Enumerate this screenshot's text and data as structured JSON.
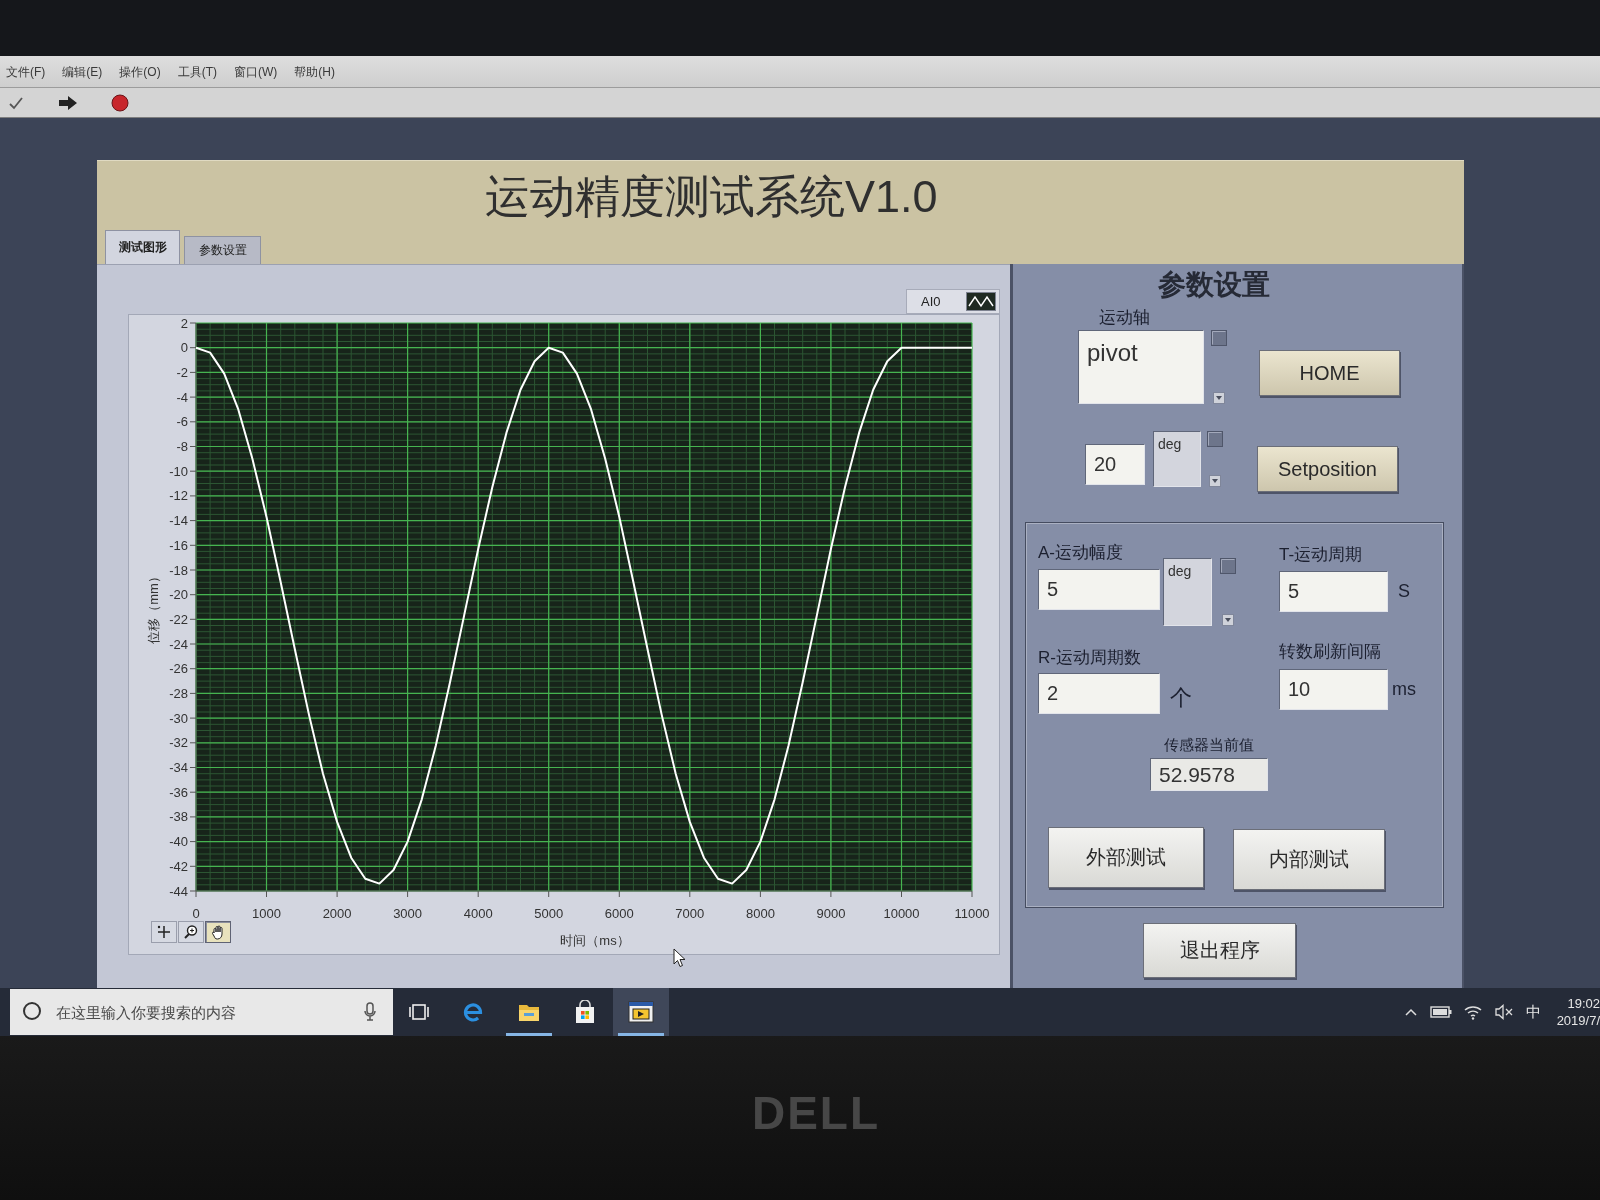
{
  "menu_bar": {
    "items": [
      "文件(F)",
      "编辑(E)",
      "操作(O)",
      "工具(T)",
      "窗口(W)",
      "帮助(H)"
    ]
  },
  "vi_panel": {
    "title": "运动精度测试系统V1.0",
    "tabs": [
      {
        "label": "测试图形",
        "selected": true
      },
      {
        "label": "参数设置",
        "selected": false
      }
    ]
  },
  "graph": {
    "chart_data": {
      "type": "line",
      "xlabel": "时间（ms）",
      "ylabel": "位移（mm）",
      "x": [
        0,
        200,
        400,
        600,
        800,
        1000,
        1200,
        1400,
        1600,
        1800,
        2000,
        2200,
        2400,
        2600,
        2800,
        3000,
        3200,
        3400,
        3600,
        3800,
        4000,
        4200,
        4400,
        4600,
        4800,
        5000,
        5200,
        5400,
        5600,
        5800,
        6000,
        6200,
        6400,
        6600,
        6800,
        7000,
        7200,
        7400,
        7600,
        7800,
        8000,
        8200,
        8400,
        8600,
        8800,
        9000,
        9200,
        9400,
        9600,
        9800,
        10000,
        10200,
        10400,
        10600,
        10800,
        11000
      ],
      "series": [
        {
          "name": "AI0",
          "color": "#ffffff",
          "values": [
            0,
            -0.4,
            -2.1,
            -5.0,
            -9.0,
            -13.7,
            -19.0,
            -24.4,
            -29.7,
            -34.5,
            -38.4,
            -41.3,
            -43.0,
            -43.4,
            -42.3,
            -40.0,
            -36.6,
            -32.2,
            -27.1,
            -21.7,
            -16.3,
            -11.3,
            -6.9,
            -3.4,
            -1.1,
            0,
            -0.4,
            -2.1,
            -5.0,
            -9.0,
            -13.7,
            -19.0,
            -24.4,
            -29.7,
            -34.5,
            -38.4,
            -41.3,
            -43.0,
            -43.4,
            -42.3,
            -40.0,
            -36.6,
            -32.2,
            -27.1,
            -21.7,
            -16.3,
            -11.3,
            -6.9,
            -3.4,
            -1.1,
            0,
            0,
            0,
            0,
            0,
            0
          ]
        }
      ],
      "xlim": [
        0,
        11000
      ],
      "ylim": [
        -44,
        2
      ],
      "xticks": [
        0,
        1000,
        2000,
        3000,
        4000,
        5000,
        6000,
        7000,
        8000,
        9000,
        10000,
        11000
      ],
      "yticks": [
        2,
        0,
        -2,
        -4,
        -6,
        -8,
        -10,
        -12,
        -14,
        -16,
        -18,
        -20,
        -22,
        -24,
        -26,
        -28,
        -30,
        -32,
        -34,
        -36,
        -38,
        -40,
        -42,
        -44
      ],
      "grid": true
    },
    "palette": [
      {
        "kind": "cursor",
        "selected": false
      },
      {
        "kind": "zoom",
        "selected": false
      },
      {
        "kind": "pan",
        "selected": true
      }
    ]
  },
  "settings": {
    "title": "参数设置",
    "axis": {
      "label": "运动轴",
      "value": "pivot"
    },
    "home_button": "HOME",
    "position": {
      "value": "20",
      "unit": "deg"
    },
    "setposition_button": "Setposition",
    "motion": {
      "amplitude": {
        "label": "A-运动幅度",
        "value": "5",
        "unit": "deg"
      },
      "period": {
        "label": "T-运动周期",
        "value": "5",
        "unit": "S"
      },
      "cycles": {
        "label": "R-运动周期数",
        "value": "2",
        "unit": "个"
      },
      "refresh_interval": {
        "label": "转数刷新间隔",
        "value": "10",
        "unit": "ms"
      },
      "sensor": {
        "label": "传感器当前值",
        "value": "52.9578"
      },
      "buttons": [
        "外部测试",
        "内部测试"
      ]
    },
    "exit_button": "退出程序"
  },
  "taskbar": {
    "search": {
      "placeholder": "在这里输入你要搜索的内容"
    },
    "apps": [
      {
        "kind": "task-view",
        "running": false,
        "active": false
      },
      {
        "kind": "browser",
        "running": false,
        "active": false
      },
      {
        "kind": "folder",
        "running": true,
        "active": false
      },
      {
        "kind": "store",
        "running": false,
        "active": false
      },
      {
        "kind": "labview",
        "running": true,
        "active": true
      }
    ],
    "tray": {
      "input_method": "中",
      "time": "19:02",
      "date": "2019/7/"
    }
  },
  "bezel": {
    "logo": "DELL"
  }
}
